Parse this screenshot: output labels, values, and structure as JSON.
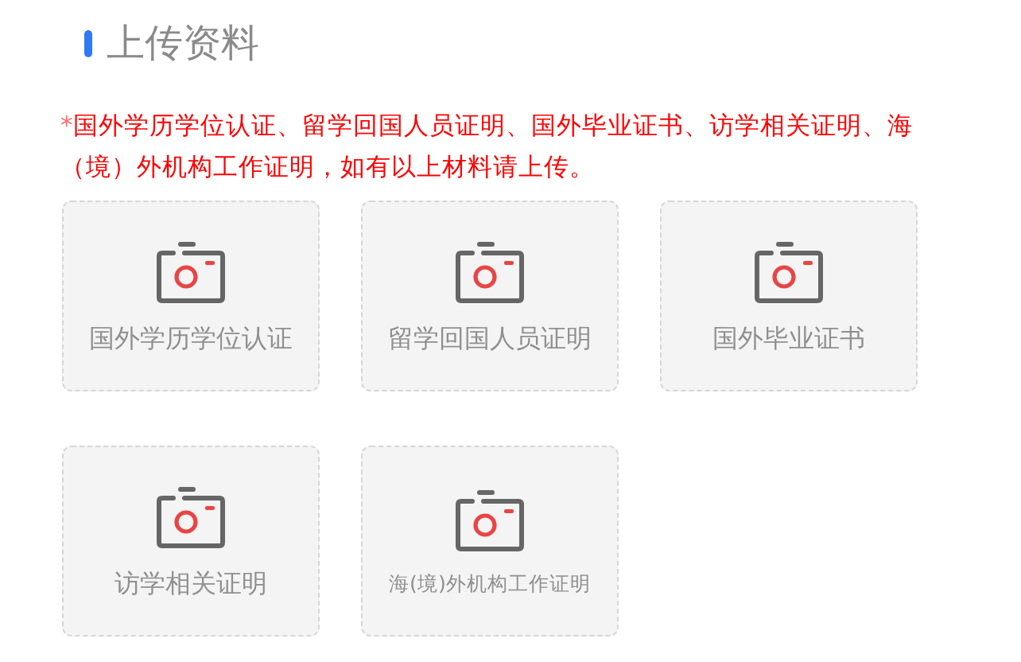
{
  "section": {
    "title": "上传资料"
  },
  "note": {
    "required_mark": "*",
    "text": "国外学历学位认证、留学回国人员证明、国外毕业证书、访学相关证明、海（境）外机构工作证明，如有以上材料请上传。"
  },
  "uploads": [
    {
      "label": "国外学历学位认证"
    },
    {
      "label": "留学回国人员证明"
    },
    {
      "label": "国外毕业证书"
    },
    {
      "label": "访学相关证明"
    },
    {
      "label": "海(境)外机构工作证明"
    }
  ]
}
